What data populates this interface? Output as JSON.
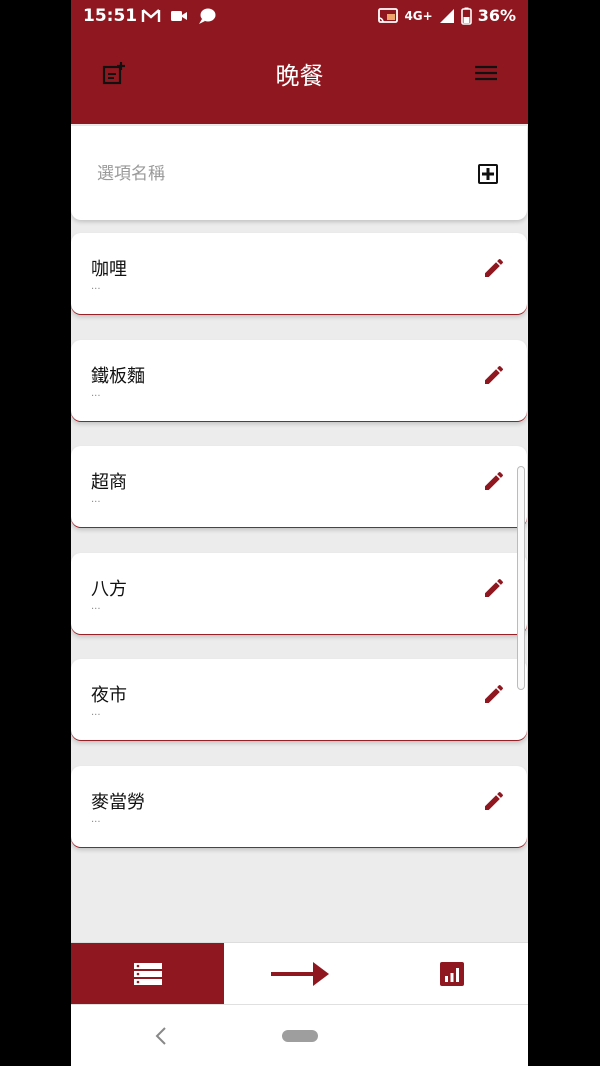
{
  "status_bar": {
    "time": "15:51",
    "network": "4G+",
    "battery": "36%",
    "left_icons": [
      "gmail-icon",
      "video-icon",
      "chat-icon"
    ],
    "right_icons": [
      "cast-icon",
      "signal-icon",
      "battery-icon"
    ]
  },
  "app_bar": {
    "title": "晚餐",
    "left_icon": "add-note-icon",
    "right_icon": "menu-icon"
  },
  "input": {
    "placeholder": "選項名稱",
    "value": "",
    "add_icon": "add-box-icon"
  },
  "items": [
    {
      "title": "咖哩",
      "subtitle": "..."
    },
    {
      "title": "鐵板麵",
      "subtitle": "..."
    },
    {
      "title": "超商",
      "subtitle": "..."
    },
    {
      "title": "八方",
      "subtitle": "..."
    },
    {
      "title": "夜市",
      "subtitle": "..."
    },
    {
      "title": "麥當勞",
      "subtitle": "..."
    }
  ],
  "bottom_nav": {
    "tabs": [
      {
        "icon": "list-icon",
        "active": true
      },
      {
        "icon": "arrow-right-icon",
        "active": false
      },
      {
        "icon": "chart-icon",
        "active": false
      }
    ]
  },
  "colors": {
    "primary": "#8f1820",
    "accent": "#b3262d",
    "background": "#ececec",
    "card": "#ffffff"
  }
}
